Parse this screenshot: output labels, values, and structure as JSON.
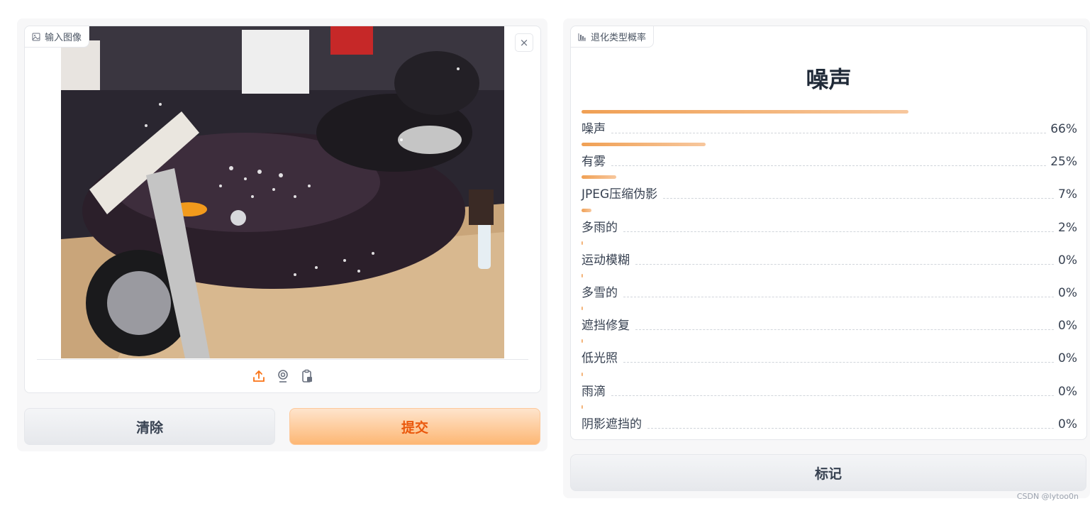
{
  "input": {
    "label": "输入图像",
    "clear_label": "清除",
    "submit_label": "提交"
  },
  "output": {
    "label": "退化类型概率",
    "top_label": "噪声",
    "flag_label": "标记",
    "confidences": [
      {
        "label": "噪声",
        "value": 0.66,
        "display": "66%"
      },
      {
        "label": "有雾",
        "value": 0.25,
        "display": "25%"
      },
      {
        "label": "JPEG压缩伪影",
        "value": 0.07,
        "display": "7%"
      },
      {
        "label": "多雨的",
        "value": 0.02,
        "display": "2%"
      },
      {
        "label": "运动模糊",
        "value": 0.0,
        "display": "0%"
      },
      {
        "label": "多雪的",
        "value": 0.0,
        "display": "0%"
      },
      {
        "label": "遮挡修复",
        "value": 0.0,
        "display": "0%"
      },
      {
        "label": "低光照",
        "value": 0.0,
        "display": "0%"
      },
      {
        "label": "雨滴",
        "value": 0.0,
        "display": "0%"
      },
      {
        "label": "阴影遮挡的",
        "value": 0.0,
        "display": "0%"
      }
    ]
  },
  "watermark": "CSDN @lytoo0n",
  "colors": {
    "accent": "#f0a054",
    "submit_text": "#ea580c"
  }
}
